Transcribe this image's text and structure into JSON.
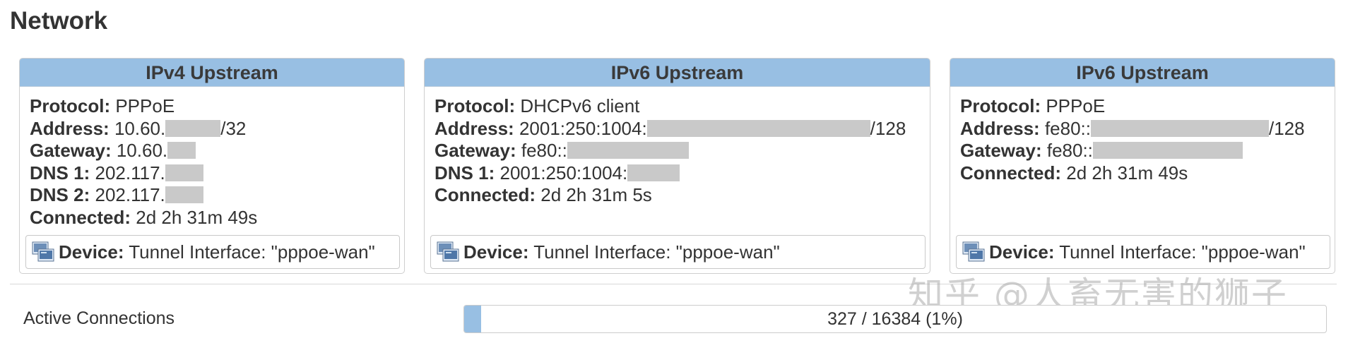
{
  "page": {
    "title": "Network"
  },
  "cards": [
    {
      "header": "IPv4 Upstream",
      "protocol_label": "Protocol:",
      "protocol": "PPPoE",
      "address_label": "Address:",
      "address_prefix": "10.60.",
      "address_suffix": "/32",
      "gateway_label": "Gateway:",
      "gateway_prefix": "10.60.",
      "dns1_label": "DNS 1:",
      "dns1_prefix": "202.117.",
      "dns2_label": "DNS 2:",
      "dns2_prefix": "202.117.",
      "connected_label": "Connected:",
      "connected": "2d 2h 31m 49s",
      "device_label": "Device:",
      "device": "Tunnel Interface: \"pppoe-wan\""
    },
    {
      "header": "IPv6 Upstream",
      "protocol_label": "Protocol:",
      "protocol": "DHCPv6 client",
      "address_label": "Address:",
      "address_prefix": "2001:250:1004:",
      "address_suffix": "/128",
      "gateway_label": "Gateway:",
      "gateway_prefix": "fe80::",
      "dns1_label": "DNS 1:",
      "dns1_prefix": "2001:250:1004:",
      "connected_label": "Connected:",
      "connected": "2d 2h 31m 5s",
      "device_label": "Device:",
      "device": "Tunnel Interface: \"pppoe-wan\""
    },
    {
      "header": "IPv6 Upstream",
      "protocol_label": "Protocol:",
      "protocol": "PPPoE",
      "address_label": "Address:",
      "address_prefix": "fe80::",
      "address_suffix": "/128",
      "gateway_label": "Gateway:",
      "gateway_prefix": "fe80::",
      "connected_label": "Connected:",
      "connected": "2d 2h 31m 49s",
      "device_label": "Device:",
      "device": "Tunnel Interface: \"pppoe-wan\""
    }
  ],
  "active_connections": {
    "label": "Active Connections",
    "text": "327 / 16384 (1%)",
    "fraction": 0.02
  },
  "watermark": "知乎 @人畜无害的狮子",
  "colors": {
    "header_bg": "#98bfe3",
    "mask": "#c9c9c9",
    "progress_fill": "#98bfe3"
  },
  "icons": {
    "device": "network-device-icon"
  }
}
